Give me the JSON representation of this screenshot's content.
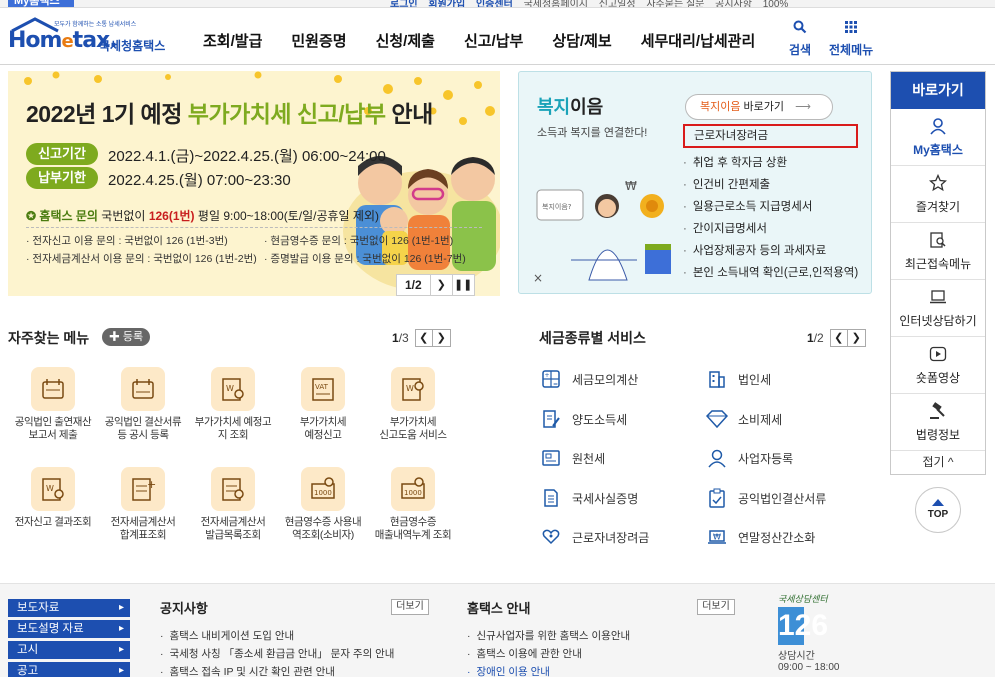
{
  "topbar": {
    "badge": "My홈택스",
    "util_links": [
      "로그인",
      "회원가입",
      "인증센터",
      "국세청홈페이지",
      "신고일정",
      "자주묻는 질문",
      "공지사항"
    ],
    "zoom": "100%"
  },
  "header": {
    "logo_word": "Hom",
    "logo_word_e": "e",
    "logo_word_end": "tax.",
    "logo_name": "국세청홈택스",
    "logo_tag": "모두가 함께하는 소통 납세서비스",
    "gnb": [
      "조회/발급",
      "민원증명",
      "신청/제출",
      "신고/납부",
      "상담/제보",
      "세무대리/납세관리"
    ],
    "search_label": "검색",
    "allmenu_label": "전체메뉴"
  },
  "banner": {
    "title_pre": "2022년 1기 예정",
    "title_hl": "부가가치세 신고/납부",
    "title_post": "안내",
    "pill1": "신고기간",
    "period1": "2022.4.1.(금)~2022.4.25.(월) 06:00~24:00",
    "pill2": "납부기한",
    "period2": "2022.4.25.(월) 07:00~23:30",
    "inq_label": "홈택스 문의",
    "inq_pre": "국번없이",
    "inq_num": "126",
    "inq_mid": "(1번)",
    "inq_post": "평일 9:00~18:00(토/일/공휴일 제외)",
    "rows": [
      [
        "· 전자신고 이용 문의 : 국번없이 126 (1번-3번)",
        "· 현금영수증 문의 : 국번없이 126 (1번-1번)"
      ],
      [
        "· 전자세금계산서 이용 문의 : 국번없이 126 (1번-2번)",
        "· 증명발급 이용 문의 : 국번없이 126 (1번-7번)"
      ]
    ],
    "page": "1/2"
  },
  "welfare": {
    "title_c": "복지",
    "title_rest": "이음",
    "sub": "소득과 복지를 연결한다!",
    "go_c": "복지이음",
    "go_rest": "바로가기",
    "first": "근로자녀장려금",
    "items": [
      "취업 후 학자금 상환",
      "인건비 간편제출",
      "일용근로소득 지급명세서",
      "간이지급명세서",
      "사업장제공자 등의 과세자료",
      "본인 소득내역 확인(근로,인적용역)"
    ]
  },
  "quick": {
    "head": "바로가기",
    "items": [
      {
        "label": "My홈택스",
        "active": true
      },
      {
        "label": "즐겨찾기",
        "active": false
      },
      {
        "label": "최근접속메뉴",
        "active": false
      },
      {
        "label": "인터넷상담하기",
        "active": false
      },
      {
        "label": "숏폼영상",
        "active": false
      },
      {
        "label": "법령정보",
        "active": false
      }
    ],
    "close": "접기 ^",
    "top": "TOP"
  },
  "freq": {
    "title": "자주찾는 메뉴",
    "reg": "등록",
    "page_cur": "1",
    "page_total": "/3",
    "items": [
      [
        "공익법인 출연재산",
        "보고서 제출"
      ],
      [
        "공익법인 결산서류",
        "등 공시 등록"
      ],
      [
        "부가가치세 예정고",
        "지 조회"
      ],
      [
        "부가가치세",
        "예정신고"
      ],
      [
        "부가가치세",
        "신고도움 서비스"
      ],
      [
        "전자신고 결과조회",
        ""
      ],
      [
        "전자세금계산서",
        "합계표조회"
      ],
      [
        "전자세금계산서",
        "발급목록조회"
      ],
      [
        "현금영수증 사용내",
        "역조회(소비자)"
      ],
      [
        "현금영수증",
        "매출내역누계 조회"
      ]
    ]
  },
  "taxsvc": {
    "title": "세금종류별 서비스",
    "page_cur": "1",
    "page_total": "/2",
    "items": [
      "세금모의계산",
      "법인세",
      "양도소득세",
      "소비제세",
      "원천세",
      "사업자등록",
      "국세사실증명",
      "공익법인결산서류",
      "근로자녀장려금",
      "연말정산간소화"
    ]
  },
  "bottom": {
    "links": [
      "보도자료",
      "보도설명 자료",
      "고시",
      "공고"
    ],
    "notice_title": "공지사항",
    "notice_more": "더보기",
    "notices": [
      "홈택스 내비게이션 도입 안내",
      "국세청 사칭 「종소세 환급금 안내」 문자 주의 안내",
      "홈택스 접속 IP 및 시간 확인 관련 안내"
    ],
    "guide_title": "홈택스 안내",
    "guide_more": "더보기",
    "guides": [
      "신규사업자를 위한 홈택스 이용안내",
      "홈택스 이용에 관한 안내",
      "장애인 이용 안내"
    ],
    "cs_label": "국세상담센터",
    "cs_num": "126",
    "cs_hours_label": "상담시간",
    "cs_hours": "09:00 ~ 18:00"
  }
}
